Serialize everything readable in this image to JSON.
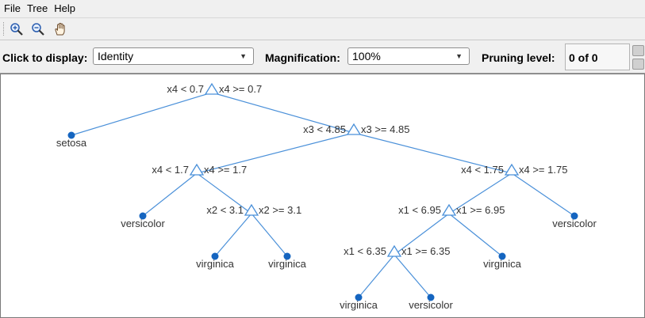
{
  "menu": {
    "items": [
      {
        "label": "File"
      },
      {
        "label": "Tree"
      },
      {
        "label": "Help"
      }
    ]
  },
  "toolbar": {
    "zoom_in_icon": "zoom-in-icon",
    "zoom_out_icon": "zoom-out-icon",
    "pan_icon": "pan-hand-icon"
  },
  "controls": {
    "click_to_display_label": "Click to display:",
    "click_to_display_value": "Identity",
    "magnification_label": "Magnification:",
    "magnification_value": "100%",
    "pruning_level_label": "Pruning level:",
    "pruning_level_value": "0 of 0"
  },
  "colors": {
    "branch": "#4a90d9",
    "leaf": "#1565c0"
  },
  "tree": {
    "splits": [
      {
        "left": "x4 < 0.7",
        "right": "x4 >= 0.7"
      },
      {
        "left": "x3 < 4.85",
        "right": "x3 >= 4.85"
      },
      {
        "left": "x4 < 1.7",
        "right": "x4 >= 1.7"
      },
      {
        "left": "x4 < 1.75",
        "right": "x4 >= 1.75"
      },
      {
        "left": "x2 < 3.1",
        "right": "x2 >= 3.1"
      },
      {
        "left": "x1 < 6.95",
        "right": "x1 >= 6.95"
      },
      {
        "left": "x1 < 6.35",
        "right": "x1 >= 6.35"
      }
    ],
    "leaves": [
      {
        "label": "setosa"
      },
      {
        "label": "versicolor"
      },
      {
        "label": "virginica"
      },
      {
        "label": "virginica"
      },
      {
        "label": "versicolor"
      },
      {
        "label": "virginica"
      },
      {
        "label": "virginica"
      },
      {
        "label": "versicolor"
      }
    ]
  }
}
